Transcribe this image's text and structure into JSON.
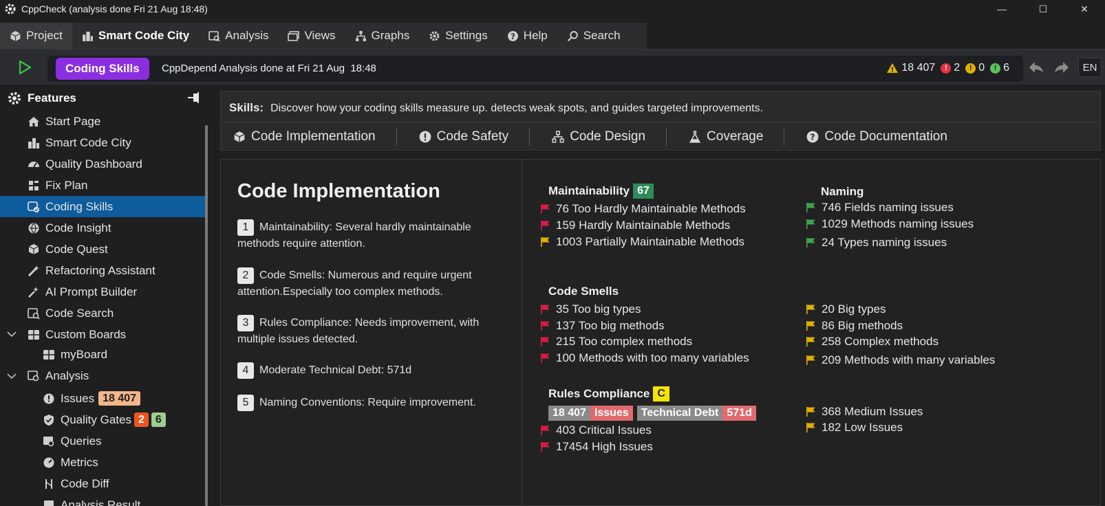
{
  "window": {
    "title": "CppCheck (analysis done Fri 21 Aug  18:48)",
    "minimize": "—",
    "maximize": "☐",
    "close": "✕"
  },
  "menu": [
    {
      "label": "Project",
      "icon": "cube-icon"
    },
    {
      "label": "Smart Code City",
      "icon": "city-icon"
    },
    {
      "label": "Analysis",
      "icon": "analysis-icon"
    },
    {
      "label": "Views",
      "icon": "views-icon"
    },
    {
      "label": "Graphs",
      "icon": "graphs-icon"
    },
    {
      "label": "Settings",
      "icon": "gear-icon"
    },
    {
      "label": "Help",
      "icon": "help-icon"
    },
    {
      "label": "Search",
      "icon": "search-icon"
    }
  ],
  "toolbar": {
    "skill_badge": "Coding Skills",
    "status": "CppDepend Analysis done at Fri 21 Aug  18:48",
    "warnings": "18 407",
    "errors": "2",
    "info": "0",
    "ok": "6",
    "lang": "EN"
  },
  "sidebar": {
    "title": "Features",
    "items": [
      {
        "label": "Start Page",
        "icon": "home-icon"
      },
      {
        "label": "Smart Code City",
        "icon": "city-icon"
      },
      {
        "label": "Quality Dashboard",
        "icon": "dashboard-icon"
      },
      {
        "label": "Fix Plan",
        "icon": "plan-icon"
      },
      {
        "label": "Coding Skills",
        "icon": "skills-icon"
      },
      {
        "label": "Code Insight",
        "icon": "insight-icon"
      },
      {
        "label": "Code Quest",
        "icon": "quest-icon"
      },
      {
        "label": "Refactoring Assistant",
        "icon": "refactor-icon"
      },
      {
        "label": "AI Prompt Builder",
        "icon": "ai-icon"
      },
      {
        "label": "Code Search",
        "icon": "code-search-icon"
      },
      {
        "label": "Custom Boards",
        "icon": "board-icon"
      },
      {
        "label": "myBoard",
        "icon": "board-icon"
      },
      {
        "label": "Analysis",
        "icon": "analysis-icon"
      },
      {
        "label": "Issues",
        "icon": "issue-icon",
        "badge": "18 407"
      },
      {
        "label": "Quality Gates",
        "icon": "gate-icon",
        "badge_red": "2",
        "badge_green": "6"
      },
      {
        "label": "Queries",
        "icon": "query-icon"
      },
      {
        "label": "Metrics",
        "icon": "metrics-icon"
      },
      {
        "label": "Code Diff",
        "icon": "diff-icon"
      },
      {
        "label": "Analysis Result",
        "icon": "result-icon"
      }
    ]
  },
  "skills": {
    "prefix": "Skills:",
    "description": "Discover how your coding skills measure up. detects weak spots, and guides targeted improvements."
  },
  "tabs": [
    {
      "label": "Code Implementation",
      "icon": "cube-icon"
    },
    {
      "label": "Code Safety",
      "icon": "alert-icon"
    },
    {
      "label": "Code Design",
      "icon": "hierarchy-icon"
    },
    {
      "label": "Coverage",
      "icon": "flask-icon"
    },
    {
      "label": "Code Documentation",
      "icon": "help-icon"
    }
  ],
  "impl": {
    "title": "Code Implementation",
    "points": [
      {
        "n": "1",
        "text": "Maintainability: Several hardly maintainable methods require attention."
      },
      {
        "n": "2",
        "text": "Code Smells: Numerous and require urgent attention.Especially too complex methods."
      },
      {
        "n": "3",
        "text": "Rules Compliance: Needs improvement, with multiple issues detected."
      },
      {
        "n": "4",
        "text": "Moderate Technical Debt: 571d"
      },
      {
        "n": "5",
        "text": "Naming Conventions: Require improvement."
      }
    ]
  },
  "maintainability": {
    "title": "Maintainability",
    "score": "67",
    "lines": [
      "76 Too Hardly Maintainable Methods",
      "159 Hardly Maintainable Methods",
      "1003 Partially Maintainable Methods"
    ]
  },
  "naming": {
    "title": "Naming",
    "lines": [
      "746 Fields naming issues",
      "1029 Methods naming issues",
      "24 Types naming issues"
    ]
  },
  "smells": {
    "title": "Code Smells",
    "red": [
      "35 Too big types",
      "137 Too big methods",
      "215 Too complex methods",
      "100 Methods with too many variables"
    ],
    "yellow": [
      "20 Big types",
      "86 Big methods",
      "258 Complex methods",
      "209 Methods with many variables"
    ]
  },
  "rules": {
    "title": "Rules Compliance",
    "grade": "C",
    "issues_count": "18 407",
    "issues_label": "Issues",
    "debt_label": "Technical Debt",
    "debt_value": "571d",
    "red": [
      "403 Critical Issues",
      "17454 High Issues"
    ],
    "yellow": [
      "368 Medium Issues",
      "182 Low Issues"
    ]
  },
  "colors": {
    "accent_purple": "#8b2ee0",
    "selection_blue": "#0e5c9b",
    "flag_red": "#d81b4a",
    "flag_yellow": "#e0b000",
    "flag_green": "#3fa34d",
    "score_green": "#2e8b57",
    "grade_yellow": "#f5e400",
    "issues_orange": "#f3b58a",
    "chip_red": "#e06a70"
  }
}
